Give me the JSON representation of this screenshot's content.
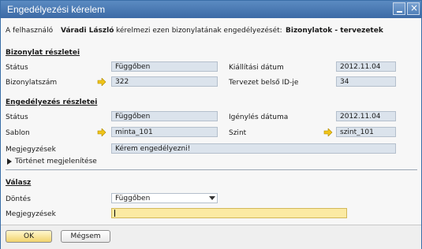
{
  "window": {
    "title": "Engedélyezési kérelem"
  },
  "intro": {
    "prefix": "A felhasználó",
    "user": "Váradi László",
    "middle": "kérelmezi ezen bizonylatának engedélyezését:",
    "doc_type": "Bizonylatok - tervezetek"
  },
  "doc_details": {
    "header": "Bizonylat részletei",
    "status_label": "Státus",
    "status_value": "Függőben",
    "issue_date_label": "Kiállítási dátum",
    "issue_date_value": "2012.11.04",
    "doc_number_label": "Bizonylatszám",
    "doc_number_value": "322",
    "draft_id_label": "Tervezet belső ID-je",
    "draft_id_value": "34"
  },
  "approval_details": {
    "header": "Engedélyezés részletei",
    "status_label": "Státus",
    "status_value": "Függőben",
    "request_date_label": "Igénylés dátuma",
    "request_date_value": "2012.11.04",
    "template_label": "Sablon",
    "template_value": "minta_101",
    "level_label": "Szint",
    "level_value": "szint_101",
    "notes_label": "Megjegyzések",
    "notes_value": "Kérem engedélyezni!",
    "history_toggle": "Történet megjelenítése"
  },
  "response": {
    "header": "Válasz",
    "decision_label": "Döntés",
    "decision_value": "Függőben",
    "notes_label": "Megjegyzések",
    "notes_value": ""
  },
  "buttons": {
    "ok": "OK",
    "cancel": "Mégsem"
  },
  "colors": {
    "titlebar": "#3c6aa5",
    "field_bg": "#dbe3ec",
    "input_active": "#fbeaa3",
    "arrow": "#f0c419",
    "button": "#f2d36b"
  }
}
